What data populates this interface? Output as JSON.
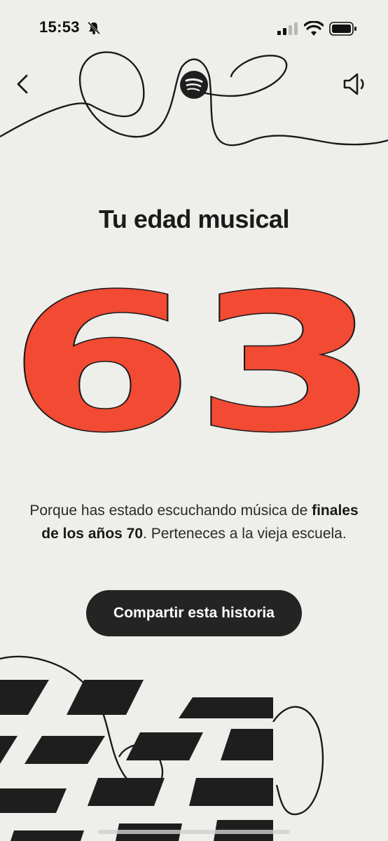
{
  "status_bar": {
    "time": "15:53",
    "icons": [
      "bell-slash-icon",
      "cellular-signal-icon",
      "wifi-icon",
      "battery-icon"
    ]
  },
  "nav": {
    "back_icon": "chevron-left-icon",
    "logo_icon": "spotify-logo-icon",
    "sound_icon": "speaker-icon"
  },
  "story": {
    "title": "Tu edad musical",
    "age": "63",
    "desc_start": "Porque has estado escuchando música de ",
    "desc_bold": "finales de los años 70",
    "desc_end": ". Perteneces a la vieja escuela.",
    "share_label": "Compartir esta historia"
  },
  "colors": {
    "background": "#eeeeea",
    "accent": "#f24a33",
    "ink": "#1b1b1b",
    "button": "#242424"
  }
}
